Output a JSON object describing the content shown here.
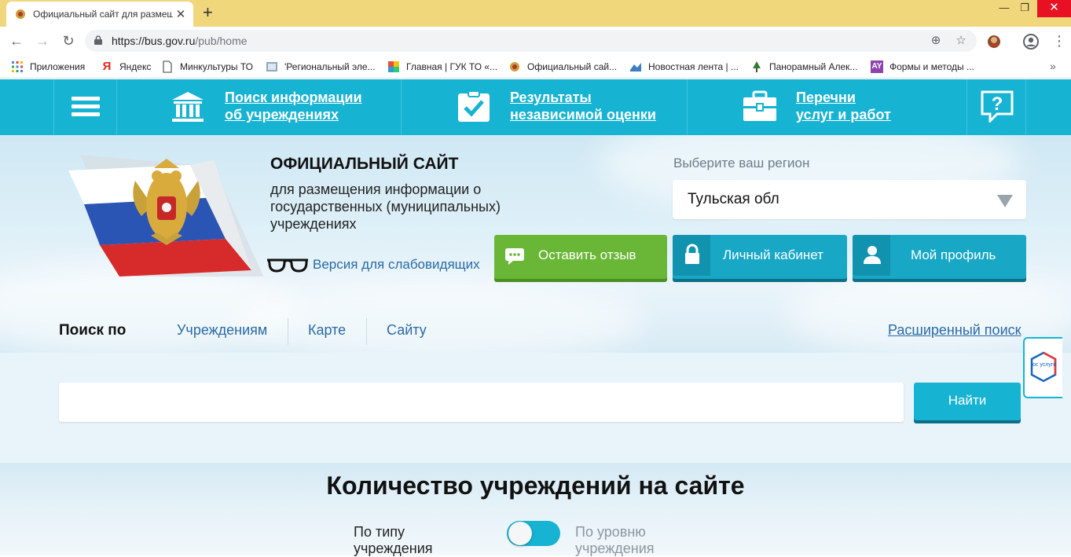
{
  "browser": {
    "tab_title": "Официальный сайт для размещ",
    "url_host": "https://bus.gov.ru",
    "url_path": "/pub/home",
    "bookmarks": [
      "Приложения",
      "Яндекс",
      "Минкультуры ТО",
      "'Региональный эле...",
      "Главная | ГУК ТО «...",
      "Официальный сай...",
      "Новостная лента | ...",
      "Панорамный Алек...",
      "Формы и методы ..."
    ]
  },
  "nav": {
    "item1_line1": "Поиск информации",
    "item1_line2": "об учреждениях",
    "item2_line1": "Результаты",
    "item2_line2": "независимой оценки",
    "item3_line1": "Перечни",
    "item3_line2": "услуг и работ"
  },
  "header": {
    "title": "ОФИЦИАЛЬНЫЙ САЙТ",
    "subtitle": "для размещения информации о государственных (муниципальных) учреждениях",
    "low_vision": "Версия для слабовидящих",
    "region_label": "Выберите ваш регион",
    "region_value": "Тульская обл",
    "btn_review": "Оставить отзыв",
    "btn_cabinet": "Личный кабинет",
    "btn_profile": "Мой профиль"
  },
  "search": {
    "by_label": "Поиск по",
    "tabs": [
      "Учреждениям",
      "Карте",
      "Сайту"
    ],
    "advanced": "Расширенный поиск",
    "placeholder": "",
    "button": "Найти"
  },
  "gosuslugi_badge": "гос услуги",
  "counts": {
    "title": "Количество учреждений на сайте",
    "toggle_left": "По типу учреждения",
    "toggle_right": "По уровню учреждения"
  },
  "colors": {
    "accent": "#17b3d2",
    "green": "#6ab636",
    "link": "#2a6aa5"
  }
}
